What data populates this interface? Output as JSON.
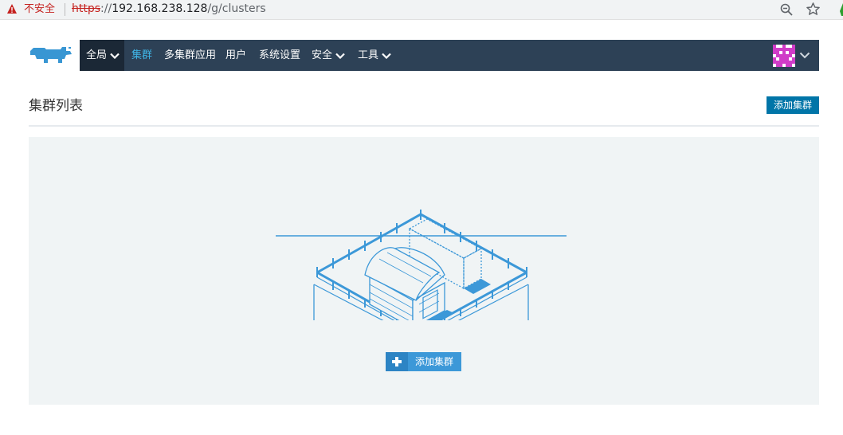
{
  "browser": {
    "security_label": "不安全",
    "url_scheme": "https",
    "url_sep": "://",
    "url_host": "192.168.238.128",
    "url_path": "/g/clusters"
  },
  "nav": {
    "global": "全局",
    "items": [
      "集群",
      "多集群应用",
      "用户",
      "系统设置",
      "安全",
      "工具"
    ],
    "active_item": "集群",
    "bg_color": "#2d4156",
    "active_color": "#3fb5e6"
  },
  "page": {
    "title": "集群列表",
    "add_button": "添加集群"
  },
  "empty_state": {
    "add_button": "添加集群",
    "illustration": "farm-empty-icon"
  },
  "colors": {
    "primary": "#0075a8",
    "illustration": "#3c98d8"
  }
}
